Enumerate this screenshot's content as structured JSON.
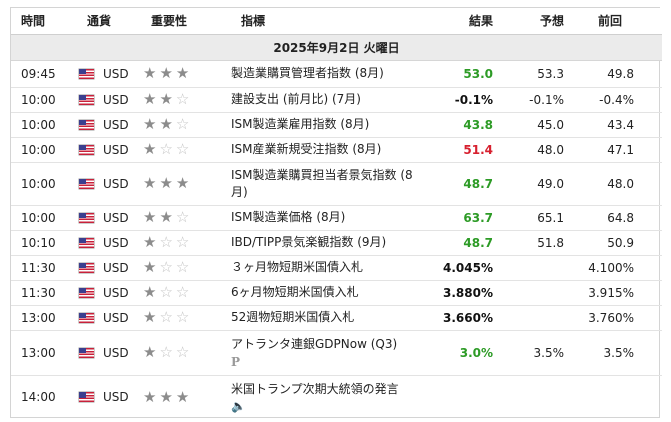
{
  "header": {
    "time": "時間",
    "currency": "通貨",
    "importance": "重要性",
    "indicator": "指標",
    "actual": "結果",
    "forecast": "予想",
    "previous": "前回"
  },
  "date_label": "2025年9月2日 火曜日",
  "colors": {
    "green": "#2d9b26",
    "red": "#d7202f",
    "black": "#111111"
  },
  "rows": [
    {
      "time": "09:45",
      "currency": "USD",
      "stars": 3,
      "indicator": "製造業購買管理者指数 (8月)",
      "actual": "53.0",
      "actual_color": "green",
      "forecast": "53.3",
      "previous": "49.8"
    },
    {
      "time": "10:00",
      "currency": "USD",
      "stars": 2,
      "indicator": "建設支出 (前月比) (7月)",
      "actual": "-0.1%",
      "actual_color": "black",
      "forecast": "-0.1%",
      "previous": "-0.4%"
    },
    {
      "time": "10:00",
      "currency": "USD",
      "stars": 2,
      "indicator": "ISM製造業雇用指数 (8月)",
      "actual": "43.8",
      "actual_color": "green",
      "forecast": "45.0",
      "previous": "43.4"
    },
    {
      "time": "10:00",
      "currency": "USD",
      "stars": 1,
      "indicator": "ISM産業新規受注指数 (8月)",
      "actual": "51.4",
      "actual_color": "red",
      "forecast": "48.0",
      "previous": "47.1"
    },
    {
      "time": "10:00",
      "currency": "USD",
      "stars": 3,
      "indicator": "ISM製造業購買担当者景気指数 (8月)",
      "actual": "48.7",
      "actual_color": "green",
      "forecast": "49.0",
      "previous": "48.0"
    },
    {
      "time": "10:00",
      "currency": "USD",
      "stars": 2,
      "indicator": "ISM製造業価格 (8月)",
      "actual": "63.7",
      "actual_color": "green",
      "forecast": "65.1",
      "previous": "64.8"
    },
    {
      "time": "10:10",
      "currency": "USD",
      "stars": 1,
      "indicator": "IBD/TIPP景気楽観指数 (9月)",
      "actual": "48.7",
      "actual_color": "green",
      "forecast": "51.8",
      "previous": "50.9"
    },
    {
      "time": "11:30",
      "currency": "USD",
      "stars": 1,
      "indicator": "３ヶ月物短期米国債入札",
      "actual": "4.045%",
      "actual_color": "black",
      "forecast": "",
      "previous": "4.100%"
    },
    {
      "time": "11:30",
      "currency": "USD",
      "stars": 1,
      "indicator": "6ヶ月物短期米国債入札",
      "actual": "3.880%",
      "actual_color": "black",
      "forecast": "",
      "previous": "3.915%"
    },
    {
      "time": "13:00",
      "currency": "USD",
      "stars": 1,
      "indicator": "52週物短期米国債入札",
      "actual": "3.660%",
      "actual_color": "black",
      "forecast": "",
      "previous": "3.760%"
    },
    {
      "time": "13:00",
      "currency": "USD",
      "stars": 1,
      "indicator": "アトランタ連銀GDPNow (Q3)",
      "actual": "3.0%",
      "actual_color": "green",
      "forecast": "3.5%",
      "previous": "3.5%",
      "sub_icon": "preliminary-p-icon",
      "sub_icon_glyph": "P"
    },
    {
      "time": "14:00",
      "currency": "USD",
      "stars": 3,
      "indicator": "米国トランプ次期大統領の発言",
      "actual": "",
      "actual_color": "black",
      "forecast": "",
      "previous": "",
      "sub_icon": "speaker-icon",
      "sub_icon_glyph": "🔈"
    }
  ]
}
